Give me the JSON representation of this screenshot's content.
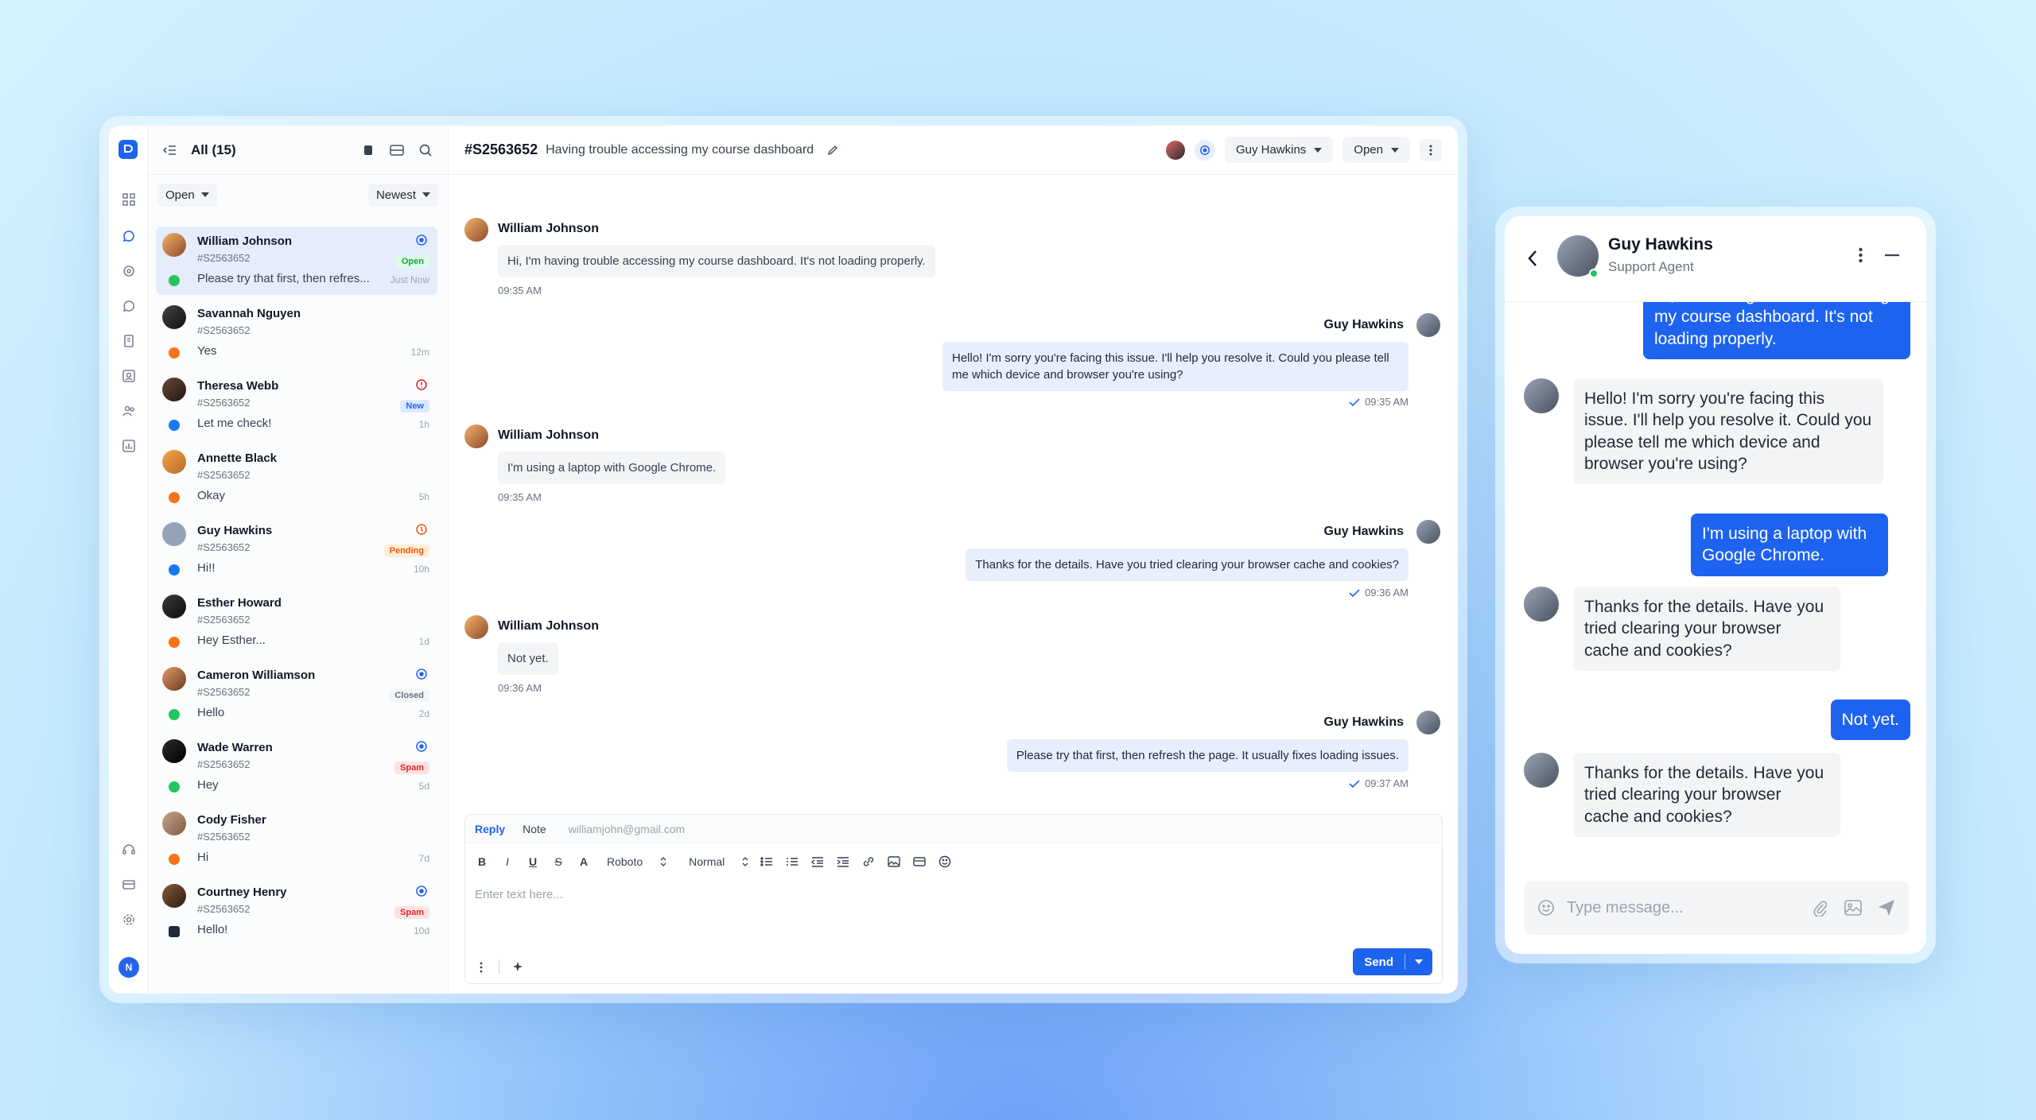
{
  "list": {
    "title": "All (15)",
    "status_filter": "Open",
    "sort_filter": "Newest",
    "conversations": [
      {
        "name": "William Johnson",
        "ticket": "#S2563652",
        "message": "Please try that first, then refres...",
        "time": "Just Now",
        "badge": "Open"
      },
      {
        "name": "Savannah Nguyen",
        "ticket": "#S2563652",
        "message": "Yes",
        "time": "12m",
        "badge": ""
      },
      {
        "name": "Theresa Webb",
        "ticket": "#S2563652",
        "message": "Let me check!",
        "time": "1h",
        "badge": "New"
      },
      {
        "name": "Annette Black",
        "ticket": "#S2563652",
        "message": "Okay",
        "time": "5h",
        "badge": ""
      },
      {
        "name": "Guy Hawkins",
        "ticket": "#S2563652",
        "message": "Hi!!",
        "time": "10h",
        "badge": "Pending"
      },
      {
        "name": "Esther Howard",
        "ticket": "#S2563652",
        "message": "Hey Esther...",
        "time": "1d",
        "badge": ""
      },
      {
        "name": "Cameron Williamson",
        "ticket": "#S2563652",
        "message": "Hello",
        "time": "2d",
        "badge": "Closed"
      },
      {
        "name": "Wade Warren",
        "ticket": "#S2563652",
        "message": "Hey",
        "time": "5d",
        "badge": "Spam"
      },
      {
        "name": "Cody Fisher",
        "ticket": "#S2563652",
        "message": "Hi",
        "time": "7d",
        "badge": ""
      },
      {
        "name": "Courtney Henry",
        "ticket": "#S2563652",
        "message": "Hello!",
        "time": "10d",
        "badge": "Spam"
      }
    ]
  },
  "chat": {
    "ticket": "#S2563652",
    "subject": "Having trouble accessing my course dashboard",
    "assignee": "Guy Hawkins",
    "status": "Open",
    "messages": [
      {
        "sender": "William Johnson",
        "text": "Hi, I'm having trouble accessing my course dashboard. It's not loading properly.",
        "time": "09:35 AM"
      },
      {
        "sender": "Guy Hawkins",
        "text": "Hello! I'm sorry you're facing this issue. I'll help you resolve it. Could you please tell me which device and browser you're using?",
        "time": "09:35 AM"
      },
      {
        "sender": "William Johnson",
        "text": "I'm using a laptop with Google Chrome.",
        "time": "09:35 AM"
      },
      {
        "sender": "Guy Hawkins",
        "text": "Thanks for the details. Have you tried clearing your browser cache and cookies?",
        "time": "09:36 AM"
      },
      {
        "sender": "William Johnson",
        "text": "Not yet.",
        "time": "09:36 AM"
      },
      {
        "sender": "Guy Hawkins",
        "text": "Please try that first, then refresh the page. It usually fixes loading issues.",
        "time": "09:37 AM"
      }
    ]
  },
  "composer": {
    "tab_reply": "Reply",
    "tab_note": "Note",
    "email": "williamjohn@gmail.com",
    "font": "Roboto",
    "style": "Normal",
    "placeholder": "Enter text here...",
    "send_label": "Send"
  },
  "widget": {
    "agent_name": "Guy Hawkins",
    "agent_role": "Support Agent",
    "messages": [
      {
        "dir": "out",
        "text": "Hi, I'm having trouble accessing my course dashboard. It's not loading properly."
      },
      {
        "dir": "in",
        "text": "Hello! I'm sorry you're facing this issue. I'll help you resolve it. Could you please tell me which device and browser you're using?"
      },
      {
        "dir": "out",
        "text": "I'm using a laptop with Google Chrome."
      },
      {
        "dir": "in",
        "text": "Thanks for the details. Have you tried clearing your browser cache and cookies?"
      },
      {
        "dir": "out",
        "text": "Not yet."
      },
      {
        "dir": "in",
        "text": "Thanks for the details. Have you tried clearing your browser cache and cookies?"
      }
    ],
    "input_placeholder": "Type message..."
  },
  "user_initial": "N",
  "colors": {
    "accent": "#1d63f0",
    "open": "#16a34a",
    "new": "#2563eb",
    "pending": "#ea580c",
    "closed": "#6b7280",
    "spam": "#dc2626"
  }
}
